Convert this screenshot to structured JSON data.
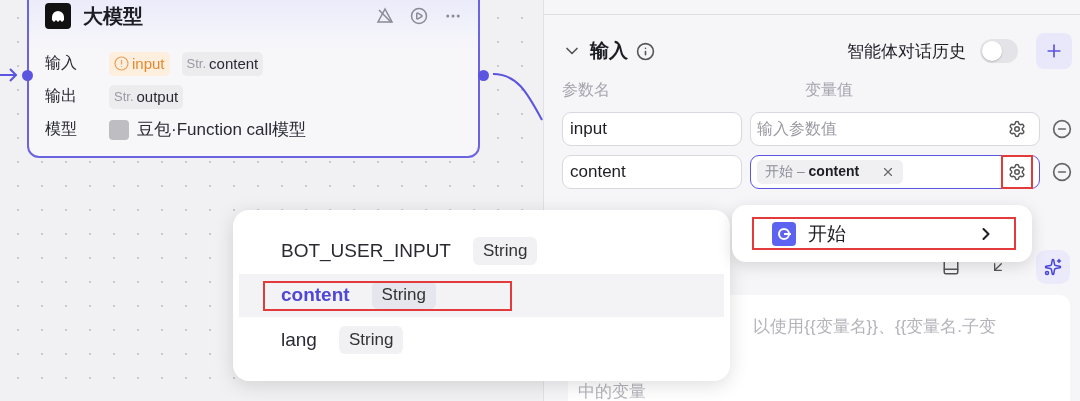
{
  "node": {
    "title": "大模型",
    "rows": [
      {
        "label": "输入",
        "tags": [
          {
            "kind": "warning",
            "text": "input"
          },
          {
            "kind": "typed",
            "type": "Str.",
            "text": "content"
          }
        ]
      },
      {
        "label": "输出",
        "tags": [
          {
            "kind": "typed",
            "type": "Str.",
            "text": "output"
          }
        ]
      },
      {
        "label": "模型",
        "tags": [
          {
            "kind": "model",
            "text": "豆包·Function call模型"
          }
        ]
      }
    ]
  },
  "inputs": {
    "title": "输入",
    "history_label": "智能体对话历史",
    "history_on": false,
    "columns": [
      "参数名",
      "变量值"
    ],
    "params": [
      {
        "name": "input",
        "value_placeholder": "输入参数值",
        "focused": false,
        "gear_highlighted": false
      },
      {
        "name": "content",
        "reference": "开始 – **content**",
        "focused": true,
        "gear_highlighted": true
      }
    ]
  },
  "prompt": {
    "lines": [
      "以使用{{变量名}}、{{变量名.子变",
      "中的变量"
    ]
  },
  "variable_menu": {
    "items": [
      {
        "name": "BOT_USER_INPUT",
        "type": "String",
        "selected": false,
        "highlighted": false
      },
      {
        "name": "content",
        "type": "String",
        "selected": true,
        "highlighted": true
      },
      {
        "name": "lang",
        "type": "String",
        "selected": false,
        "highlighted": false
      }
    ]
  },
  "source_menu": {
    "items": [
      {
        "label": "开始",
        "highlighted": true
      }
    ]
  }
}
